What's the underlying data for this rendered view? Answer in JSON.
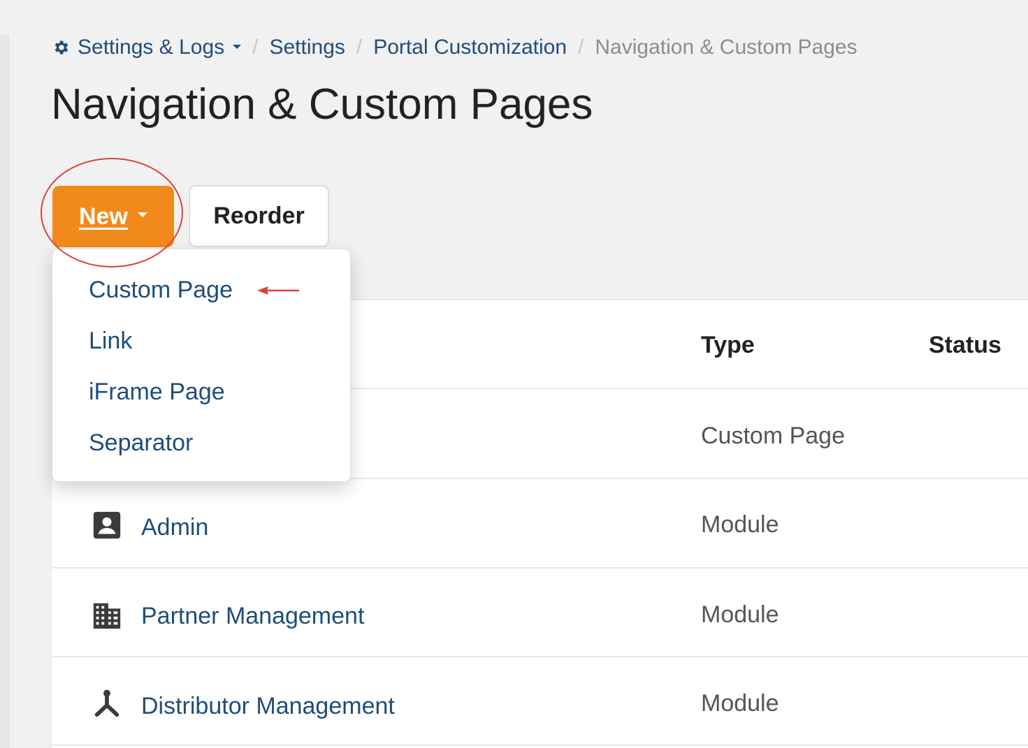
{
  "breadcrumb": {
    "settings_logs": "Settings & Logs",
    "settings": "Settings",
    "portal_customization": "Portal Customization",
    "current": "Navigation & Custom Pages",
    "separator": "/"
  },
  "page_title": "Navigation & Custom Pages",
  "toolbar": {
    "new_label": "New",
    "reorder_label": "Reorder"
  },
  "dropdown": {
    "items": [
      {
        "label": "Custom Page"
      },
      {
        "label": "Link"
      },
      {
        "label": "iFrame Page"
      },
      {
        "label": "Separator"
      }
    ]
  },
  "table": {
    "columns": {
      "type": "Type",
      "status": "Status"
    },
    "rows": [
      {
        "name": "",
        "type": "Custom Page",
        "icon": "custom-page"
      },
      {
        "name": "Admin",
        "type": "Module",
        "icon": "person-card-icon"
      },
      {
        "name": "Partner Management",
        "type": "Module",
        "icon": "building-icon"
      },
      {
        "name": "Distributor Management",
        "type": "Module",
        "icon": "network-icon"
      }
    ]
  },
  "colors": {
    "primary_button": "#f28a1b",
    "link": "#1f4e79",
    "annotation": "#d9433d",
    "background": "#f1f1f1"
  },
  "icons": {
    "breadcrumb": "gear-icon",
    "dropdown_caret": "caret-down-icon"
  }
}
